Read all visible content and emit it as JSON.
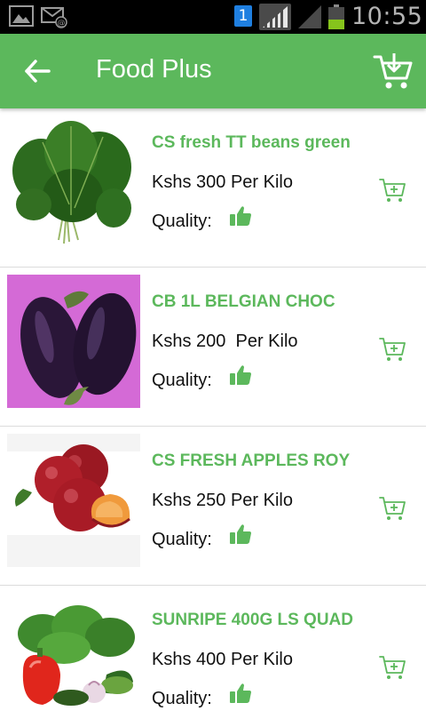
{
  "status_bar": {
    "time": "10:55",
    "sim_badge": "1",
    "icons": [
      "gallery-icon",
      "mail-icon",
      "sim-icon",
      "signal-icon",
      "signal-icon",
      "battery-icon"
    ],
    "battery_level": 0.45
  },
  "app_bar": {
    "title": "Food Plus",
    "background": "#5cb85c",
    "back_icon": "arrow-left-icon",
    "cart_icon": "cart-icon"
  },
  "colors": {
    "accent": "#5cb85c"
  },
  "products": [
    {
      "name": "CS fresh TT beans green",
      "price": "Kshs 300 Per Kilo",
      "quality_label": "Quality:",
      "image": "spinach-image"
    },
    {
      "name": "CB 1L BELGIAN CHOC",
      "price": "Kshs 200  Per Kilo",
      "quality_label": "Quality:",
      "image": "eggplant-image"
    },
    {
      "name": "CS FRESH APPLES ROY",
      "price": "Kshs 250 Per Kilo",
      "quality_label": "Quality:",
      "image": "plums-image"
    },
    {
      "name": "SUNRIPE 400G LS QUAD",
      "price": "Kshs 400 Per Kilo",
      "quality_label": "Quality:",
      "image": "vegetables-image"
    }
  ]
}
